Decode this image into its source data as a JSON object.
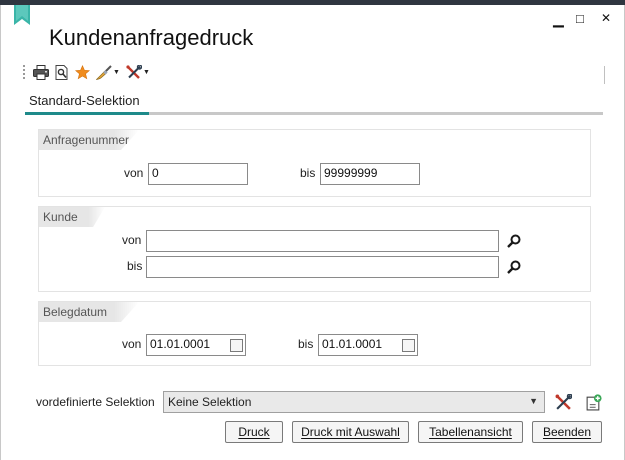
{
  "window": {
    "title": "Kundenanfragedruck",
    "controls": {
      "minimize": "▁",
      "maximize": "□",
      "close": "✕"
    }
  },
  "toolbar": {
    "items": [
      {
        "icon": "printer-icon"
      },
      {
        "icon": "print-preview-icon"
      },
      {
        "icon": "favorite-star-icon"
      },
      {
        "icon": "brush-icon",
        "has_dropdown": true
      },
      {
        "icon": "tools-icon",
        "has_dropdown": true
      }
    ]
  },
  "tabs": [
    {
      "label": "Standard-Selektion",
      "active": true
    }
  ],
  "groups": {
    "anfragenummer": {
      "title": "Anfragenummer",
      "von_label": "von",
      "von_value": "0",
      "bis_label": "bis",
      "bis_value": "99999999"
    },
    "kunde": {
      "title": "Kunde",
      "von_label": "von",
      "von_value": "",
      "bis_label": "bis",
      "bis_value": ""
    },
    "belegdatum": {
      "title": "Belegdatum",
      "von_label": "von",
      "von_value": "01.01.0001",
      "bis_label": "bis",
      "bis_value": "01.01.0001"
    }
  },
  "preselection": {
    "label": "vordefinierte Selektion",
    "selected": "Keine Selektion"
  },
  "buttons": {
    "druck": "Druck",
    "druck_mit_auswahl": "Druck mit Auswahl",
    "tabellenansicht": "Tabellenansicht",
    "beenden": "Beenden"
  },
  "colors": {
    "accent": "#1e8a8a",
    "titlebar_dark": "#2f3640",
    "star": "#f08c1e"
  }
}
